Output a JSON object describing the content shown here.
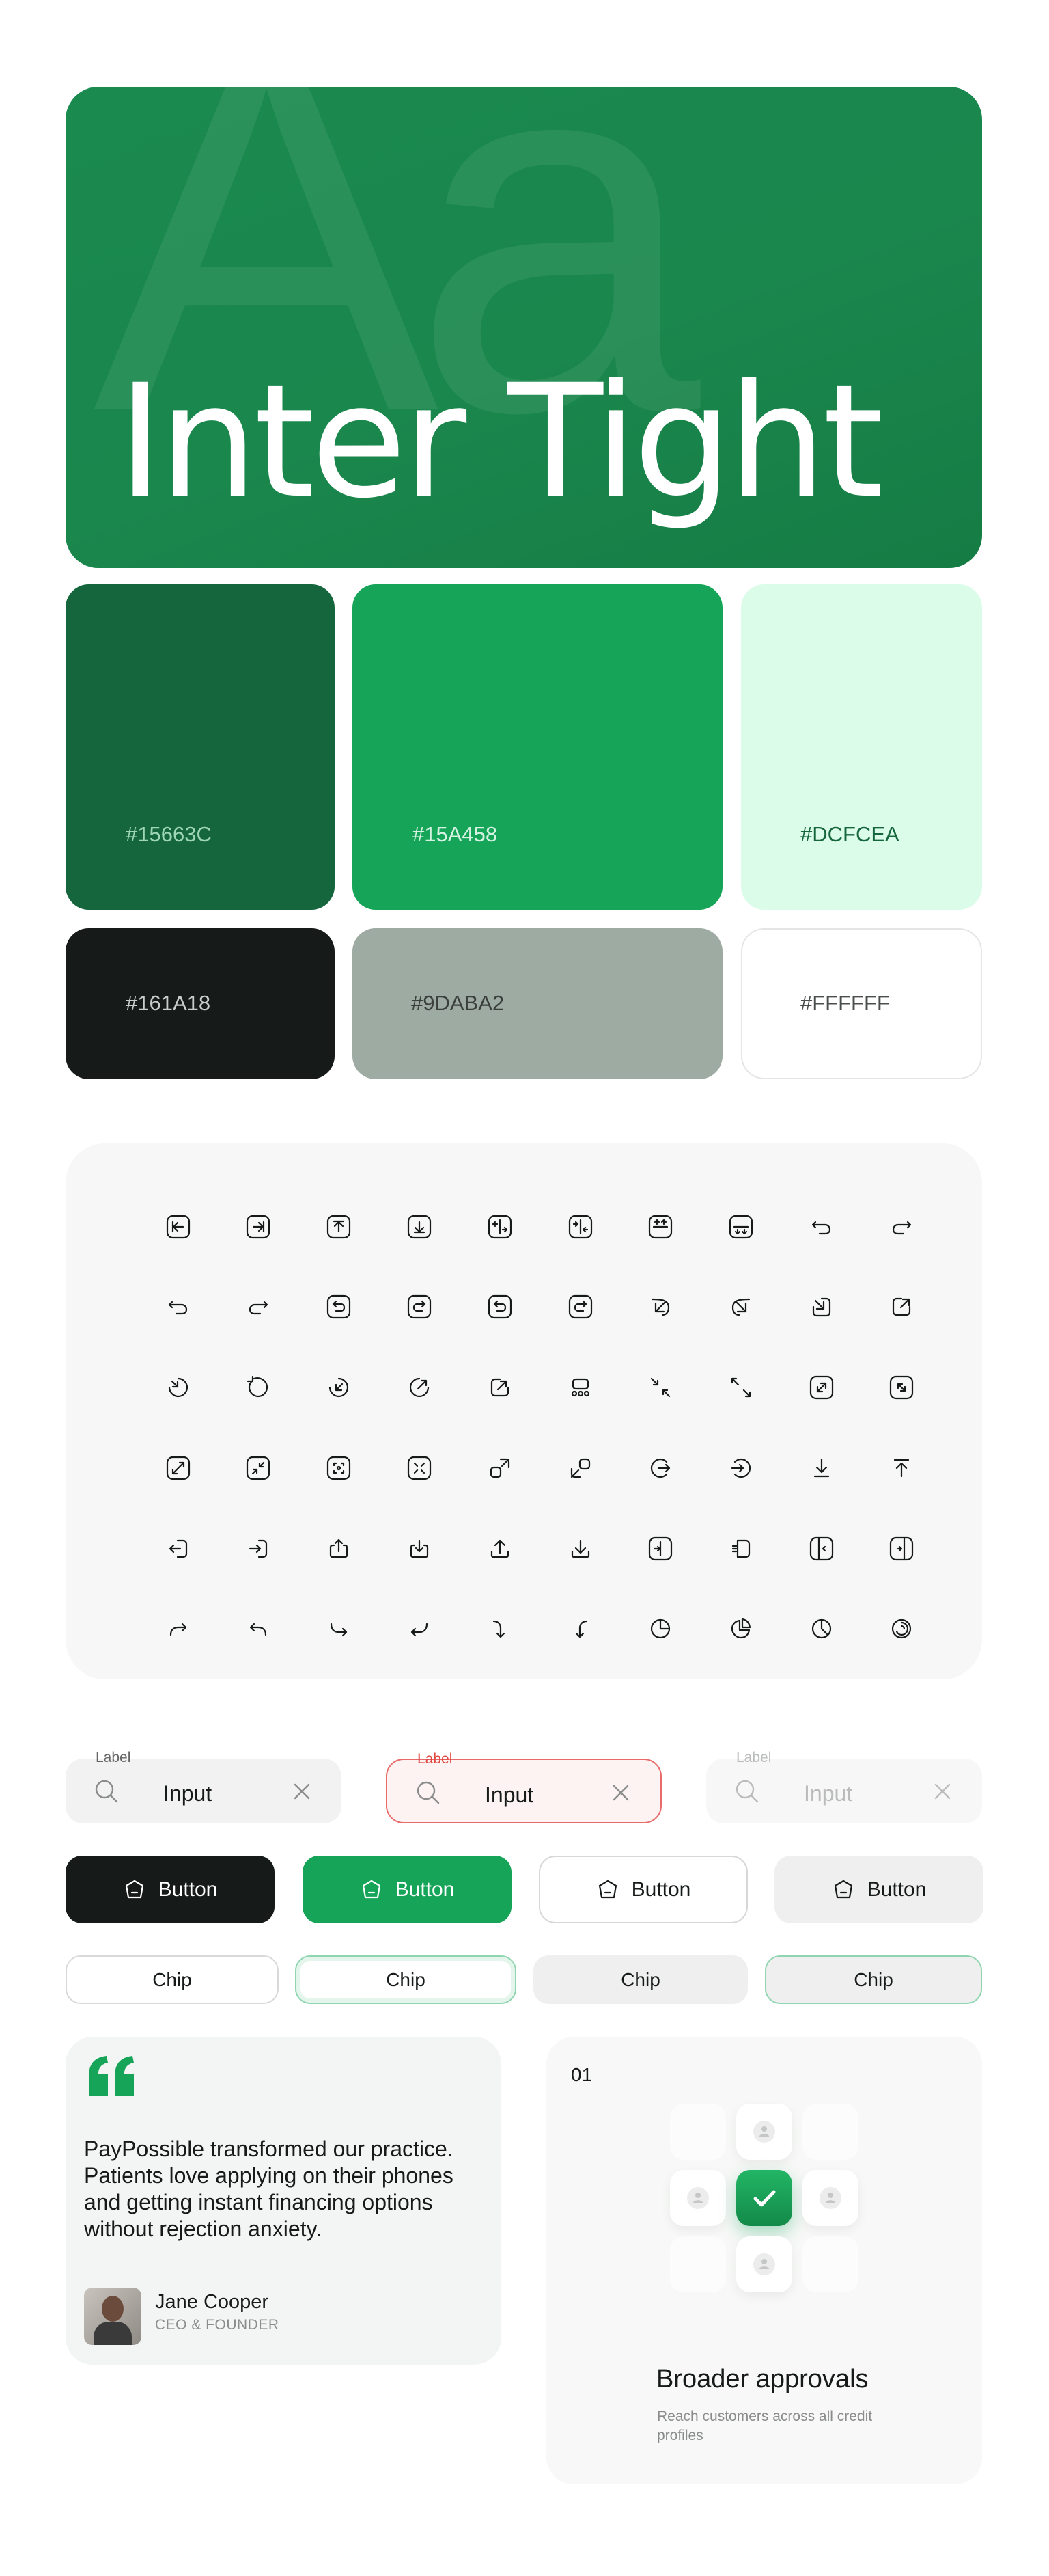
{
  "hero": {
    "background_glyphs": "Aa",
    "title": "Inter Tight",
    "gradient": [
      "#1b8a4f",
      "#157c44"
    ]
  },
  "palette": [
    {
      "hex": "#15663C",
      "label": "#15663C",
      "text_color": "#9fd6b8"
    },
    {
      "hex": "#15A458",
      "label": "#15A458",
      "text_color": "#d5f2e2"
    },
    {
      "hex": "#DCFCEA",
      "label": "#DCFCEA",
      "text_color": "#15663C"
    },
    {
      "hex": "#161A18",
      "label": "#161A18",
      "text_color": "#c9cdcb"
    },
    {
      "hex": "#9DABA2",
      "label": "#9DABA2",
      "text_color": "#3a3f3c"
    },
    {
      "hex": "#FFFFFF",
      "label": "#FFFFFF",
      "text_color": "#4a4f4c"
    }
  ],
  "icons": [
    [
      "arrow-left-to-line-square-icon",
      "arrow-right-to-line-square-icon",
      "arrow-up-to-line-square-icon",
      "arrow-down-to-line-square-icon",
      "arrows-left-right-column-icon",
      "arrows-right-left-column-icon",
      "arrows-up-row-icon",
      "arrows-down-row-icon",
      "undo-icon",
      "redo-icon"
    ],
    [
      "undo-curve-icon",
      "redo-curve-icon",
      "undo-square-icon",
      "redo-square-icon",
      "undo-square-alt-icon",
      "redo-square-alt-icon",
      "arrow-corner-up-left-icon",
      "arrow-corner-down-left-icon",
      "arrow-down-left-square-icon",
      "arrow-up-right-square-icon"
    ],
    [
      "arrow-rotate-in-icon",
      "arrow-rotate-left-icon",
      "arrow-down-left-circle-icon",
      "arrow-up-right-circle-icon",
      "share-square-icon",
      "group-icon",
      "collapse-icon",
      "expand-icon",
      "expand-square-icon",
      "expand-square-alt-icon"
    ],
    [
      "maximize-square-icon",
      "minimize-square-icon",
      "focus-square-icon",
      "shrink-square-icon",
      "corners-expand-icon",
      "corners-shrink-icon",
      "logout-circle-icon",
      "login-circle-icon",
      "download-simple-icon",
      "upload-simple-icon"
    ],
    [
      "exit-left-icon",
      "enter-right-icon",
      "upload-tray-icon",
      "download-tray-icon",
      "upload-line-icon",
      "download-line-icon",
      "sign-in-icon",
      "sign-out-icon",
      "panel-left-icon",
      "panel-right-icon"
    ],
    [
      "forward-icon",
      "reply-icon",
      "share-forward-icon",
      "return-icon",
      "turn-down-icon",
      "arrow-down-left-icon",
      "pie-chart-icon",
      "pie-chart-alt-icon",
      "pie-chart-quarter-icon",
      "loader-circle-icon"
    ]
  ],
  "inputs": [
    {
      "label": "Label",
      "value": "Input",
      "state": "default"
    },
    {
      "label": "Label",
      "value": "Input",
      "state": "error"
    },
    {
      "label": "Label",
      "value": "Input",
      "state": "disabled"
    }
  ],
  "buttons": [
    {
      "label": "Button",
      "variant": "dark"
    },
    {
      "label": "Button",
      "variant": "green"
    },
    {
      "label": "Button",
      "variant": "outline"
    },
    {
      "label": "Button",
      "variant": "gray"
    }
  ],
  "chips": [
    "Chip",
    "Chip",
    "Chip",
    "Chip"
  ],
  "testimonial": {
    "quote": "PayPossible transformed our practice. Patients love applying on their phones and getting instant financing options without rejection anxiety.",
    "name": "Jane Cooper",
    "role": "CEO & FOUNDER"
  },
  "feature": {
    "number": "01",
    "title": "Broader approvals",
    "subtitle": "Reach customers across all credit profiles"
  },
  "colors": {
    "brand_green": "#15A458",
    "dark": "#161A18",
    "error_red": "#e0453f"
  }
}
